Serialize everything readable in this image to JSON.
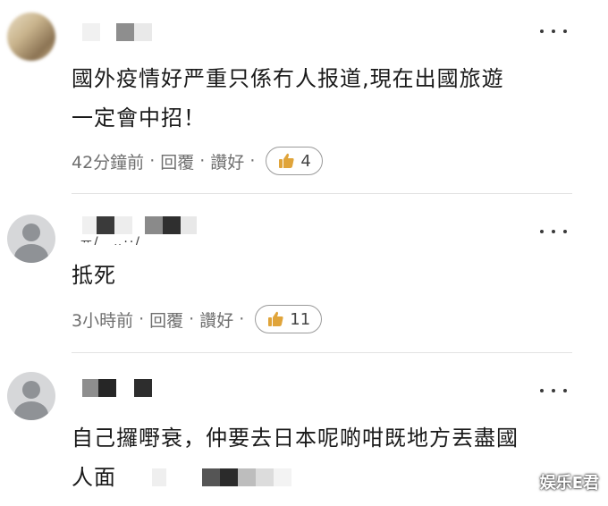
{
  "comments": [
    {
      "text_line1": "國外疫情好严重只係冇人报道,現在出國旅遊",
      "text_line2": "一定會中招！",
      "time": "42分鐘前",
      "reply": "回覆",
      "like": "讚好",
      "like_count": "4"
    },
    {
      "username_fragment": "ᅲ/ _‥··/",
      "text": "抵死",
      "time": "3小時前",
      "reply": "回覆",
      "like": "讚好",
      "like_count": "11"
    },
    {
      "text_line1": "自己攞嘢衰，仲要去日本呢啲咁既地方丟盡國",
      "text_line2": "人面"
    }
  ],
  "separator_dot": "·",
  "icons": {
    "more": "more-horizontal-icon",
    "like": "thumbs-up-icon"
  },
  "colors": {
    "thumb": "#e0a43a",
    "text": "#1a1a1a",
    "meta": "#6f6f6f"
  },
  "watermark": "娱乐E君"
}
